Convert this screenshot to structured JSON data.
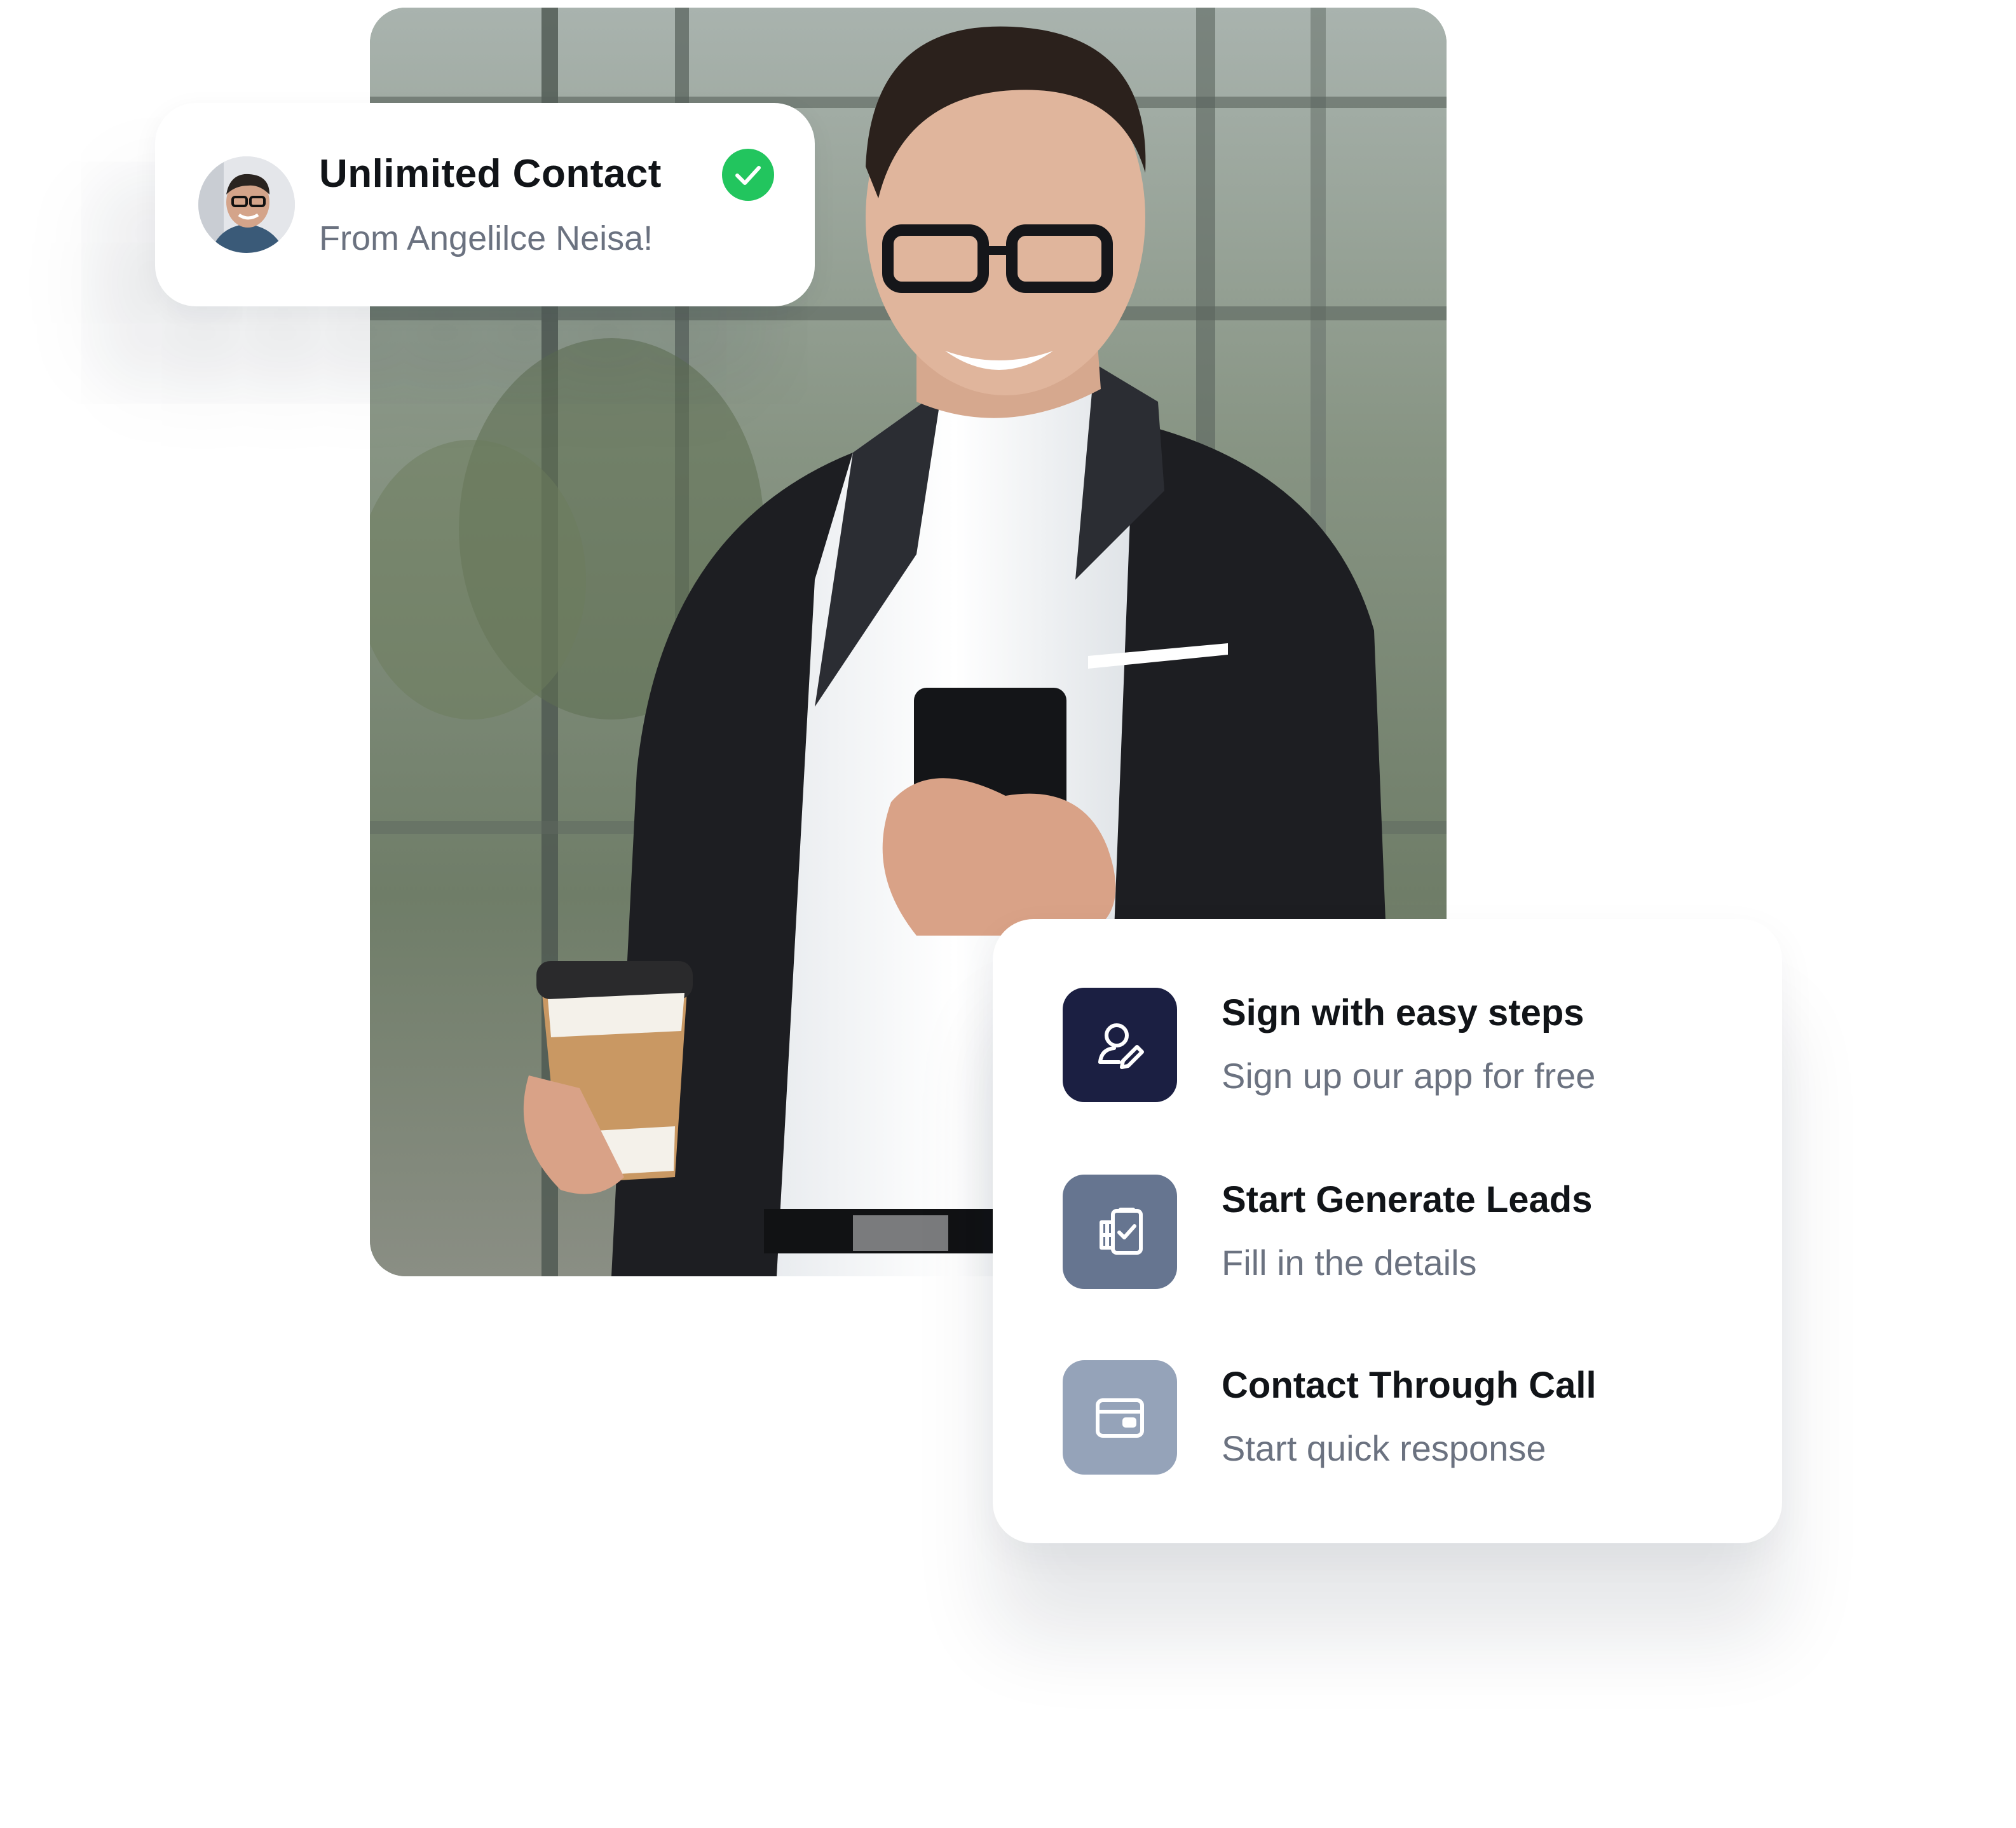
{
  "notification": {
    "title": "Unlimited Contact",
    "subtitle": "From Angelilce Neisa!",
    "avatar_icon": "person-avatar",
    "badge_icon": "check-circle-icon",
    "badge_color": "#22c55e"
  },
  "photo": {
    "subject_icon": "businessman-with-phone-photo"
  },
  "steps": [
    {
      "title": "Sign with easy steps",
      "subtitle": "Sign up our app for free",
      "icon": "user-edit-icon",
      "color": "#1b1f42"
    },
    {
      "title": "Start Generate Leads",
      "subtitle": "Fill in the details",
      "icon": "clipboard-check-icon",
      "color": "#667590"
    },
    {
      "title": "Contact Through Call",
      "subtitle": "Start quick response",
      "icon": "card-icon",
      "color": "#95a3b9"
    }
  ]
}
